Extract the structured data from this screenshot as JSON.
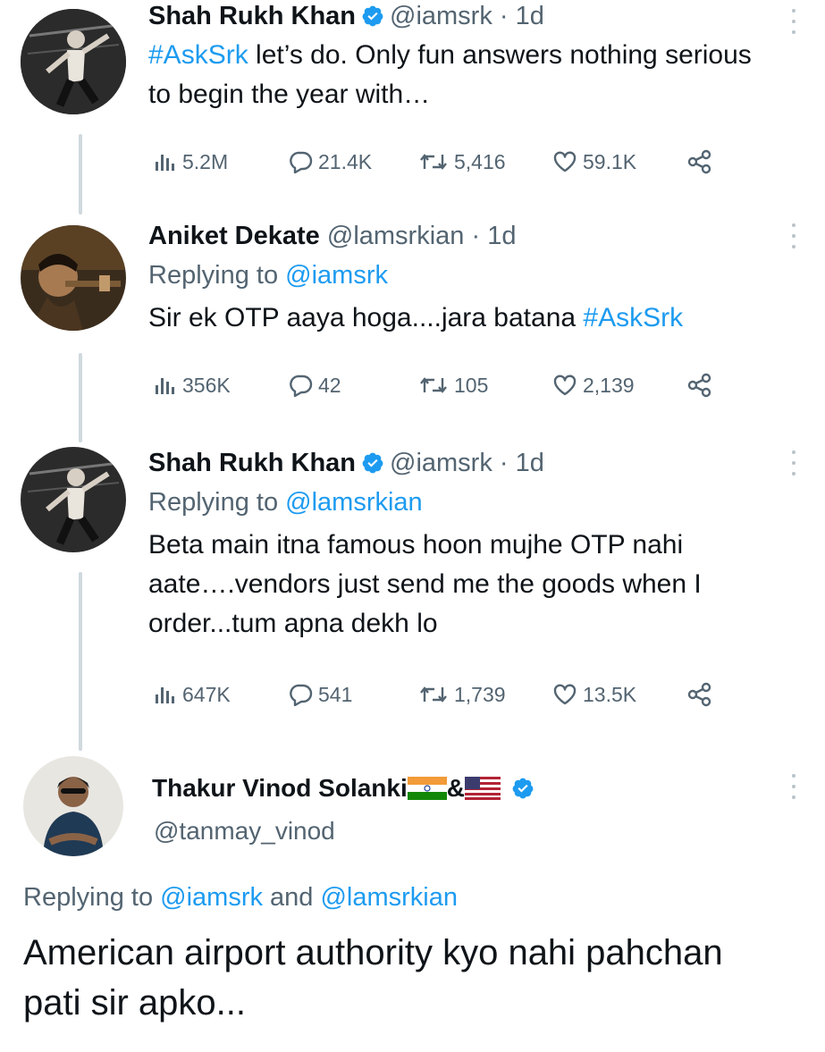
{
  "tweets": [
    {
      "name": "Shah Rukh Khan",
      "handle": "@iamsrk",
      "dot": "·",
      "time": "1d",
      "text_hashtag": "#AskSrk",
      "text_rest": " let’s do. Only fun answers nothing serious to begin the year with…",
      "views": "5.2M",
      "replies": "21.4K",
      "retweets": "5,416",
      "likes": "59.1K"
    },
    {
      "name": "Aniket Dekate",
      "handle": "@lamsrkian",
      "dot": "·",
      "time": "1d",
      "replying_prefix": "Replying to ",
      "replying_to": "@iamsrk",
      "text_main": "Sir ek OTP aaya hoga....jara batana ",
      "text_hashtag": "#AskSrk",
      "views": "356K",
      "replies": "42",
      "retweets": "105",
      "likes": "2,139"
    },
    {
      "name": "Shah Rukh Khan",
      "handle": "@iamsrk",
      "dot": "·",
      "time": "1d",
      "replying_prefix": "Replying to ",
      "replying_to": "@lamsrkian",
      "text": "Beta main itna famous hoon mujhe OTP nahi aate….vendors just send me the goods when I order...tum apna dekh lo",
      "views": "647K",
      "replies": "541",
      "retweets": "1,739",
      "likes": "13.5K"
    }
  ],
  "last_tweet": {
    "name": "Thakur Vinod Solanki",
    "name_amp": "&",
    "handle": "@tanmay_vinod",
    "replying_prefix": "Replying to ",
    "replying_to_1": "@iamsrk",
    "replying_and": " and ",
    "replying_to_2": "@lamsrkian",
    "text": "American airport authority kyo nahi pahchan pati sir apko..."
  },
  "colors": {
    "accent": "#1d9bf0",
    "secondary_text": "#536471",
    "primary_text": "#0f1419",
    "thread_line": "#cfd9de"
  },
  "icons": [
    "views-icon",
    "reply-icon",
    "retweet-icon",
    "like-icon",
    "share-icon",
    "verified-icon",
    "more-icon",
    "flag-india-icon",
    "flag-usa-icon"
  ]
}
